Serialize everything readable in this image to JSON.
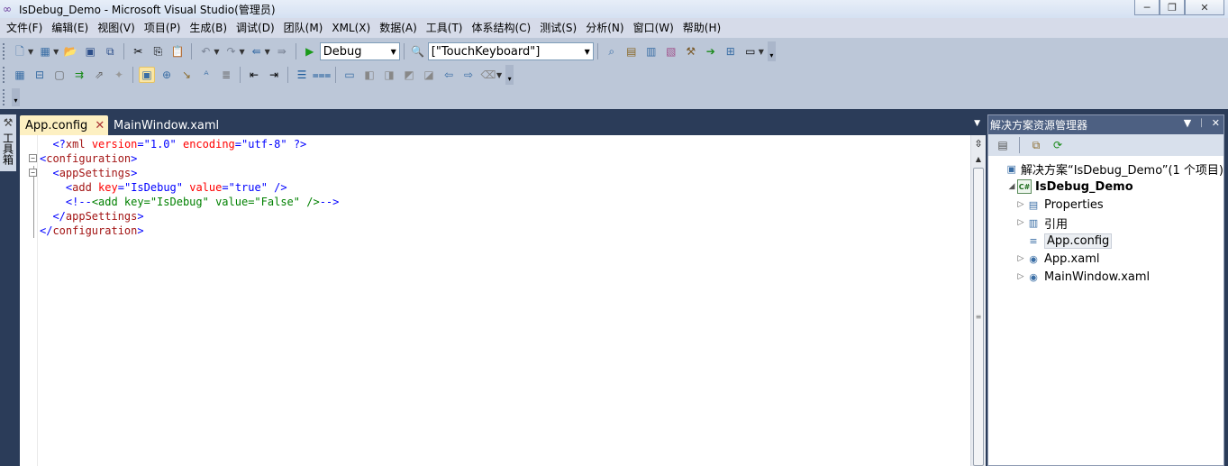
{
  "window": {
    "title": "IsDebug_Demo - Microsoft Visual Studio(管理员)",
    "app_icon": "visual-studio-infinity-icon",
    "buttons": {
      "minimize": "─",
      "restore": "❐",
      "close": "✕"
    }
  },
  "menu": [
    "文件(F)",
    "编辑(E)",
    "视图(V)",
    "项目(P)",
    "生成(B)",
    "调试(D)",
    "团队(M)",
    "XML(X)",
    "数据(A)",
    "工具(T)",
    "体系结构(C)",
    "测试(S)",
    "分析(N)",
    "窗口(W)",
    "帮助(H)"
  ],
  "toolbar": {
    "config_combo": "Debug",
    "find_combo": "[\"TouchKeyboard\"]"
  },
  "toolbox": {
    "label": "工具箱"
  },
  "tabs": [
    {
      "label": "App.config",
      "active": true,
      "close": "✕"
    },
    {
      "label": "MainWindow.xaml",
      "active": false
    }
  ],
  "tab_dropdown": "▼",
  "editor": {
    "lines": [
      {
        "indent": "  ",
        "parts": [
          [
            "br",
            "<?"
          ],
          [
            "el",
            "xml"
          ],
          [
            "at",
            " version"
          ],
          [
            "br",
            "="
          ],
          [
            "va",
            "\"1.0\""
          ],
          [
            "at",
            " encoding"
          ],
          [
            "br",
            "="
          ],
          [
            "va",
            "\"utf-8\""
          ],
          [
            "br",
            " ?>"
          ]
        ]
      },
      {
        "indent": "",
        "fold": "−",
        "parts": [
          [
            "br",
            "<"
          ],
          [
            "el",
            "configuration"
          ],
          [
            "br",
            ">"
          ]
        ]
      },
      {
        "indent": "  ",
        "fold": "−",
        "parts": [
          [
            "br",
            "<"
          ],
          [
            "el",
            "appSettings"
          ],
          [
            "br",
            ">"
          ]
        ]
      },
      {
        "indent": "    ",
        "parts": [
          [
            "br",
            "<"
          ],
          [
            "el",
            "add"
          ],
          [
            "at",
            " key"
          ],
          [
            "br",
            "="
          ],
          [
            "va",
            "\"IsDebug\""
          ],
          [
            "at",
            " value"
          ],
          [
            "br",
            "="
          ],
          [
            "va",
            "\"true\""
          ],
          [
            "br",
            " />"
          ]
        ]
      },
      {
        "indent": "    ",
        "parts": [
          [
            "br",
            "<!--"
          ],
          [
            "cm",
            "<add key=\"IsDebug\" value=\"False\" />"
          ],
          [
            "br",
            "-->"
          ]
        ]
      },
      {
        "indent": "  ",
        "parts": [
          [
            "br",
            "</"
          ],
          [
            "el",
            "appSettings"
          ],
          [
            "br",
            ">"
          ]
        ]
      },
      {
        "indent": "",
        "parts": [
          [
            "br",
            "</"
          ],
          [
            "el",
            "configuration"
          ],
          [
            "br",
            ">"
          ]
        ]
      }
    ]
  },
  "solution_explorer": {
    "title": "解决方案资源管理器",
    "title_buttons": [
      "▼",
      "ᛁ",
      "✕"
    ],
    "tree": [
      {
        "label": "解决方案“IsDebug_Demo”(1 个项目)",
        "level": 0,
        "icon": "solution-icon",
        "glyph": "▣",
        "exp": ""
      },
      {
        "label": "IsDebug_Demo",
        "level": 1,
        "icon": "csharp-project-icon",
        "glyph": "C#",
        "exp": "◢",
        "bold": true
      },
      {
        "label": "Properties",
        "level": 2,
        "icon": "properties-icon",
        "glyph": "▤",
        "exp": "▷"
      },
      {
        "label": "引用",
        "level": 2,
        "icon": "references-icon",
        "glyph": "▥",
        "exp": "▷"
      },
      {
        "label": "App.config",
        "level": 2,
        "icon": "config-file-icon",
        "glyph": "≡",
        "exp": "",
        "selected": true
      },
      {
        "label": "App.xaml",
        "level": 2,
        "icon": "xaml-file-icon",
        "glyph": "◉",
        "exp": "▷"
      },
      {
        "label": "MainWindow.xaml",
        "level": 2,
        "icon": "xaml-file-icon",
        "glyph": "◉",
        "exp": "▷"
      }
    ]
  }
}
